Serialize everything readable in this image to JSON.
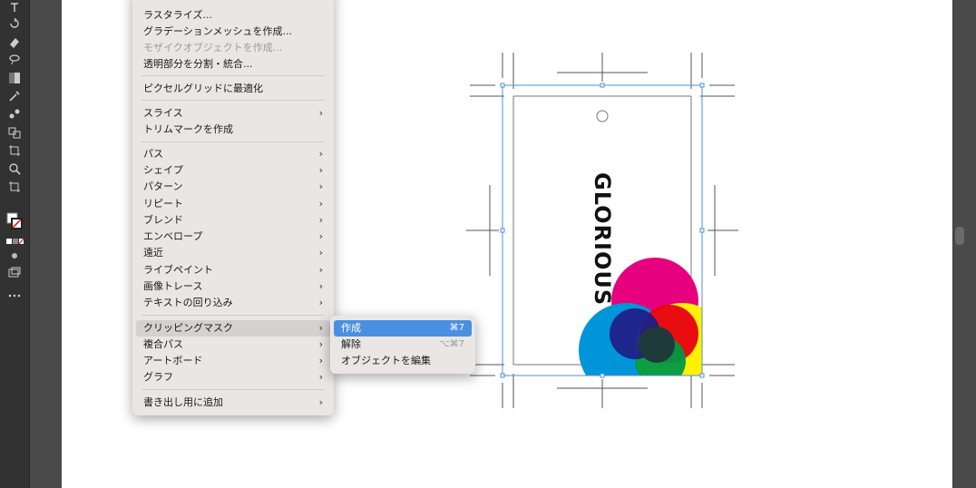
{
  "menu": {
    "items": [
      {
        "label": "ラスタライズ...",
        "arrow": "",
        "disabled": false
      },
      {
        "label": "グラデーションメッシュを作成...",
        "arrow": "",
        "disabled": false
      },
      {
        "label": "モザイクオブジェクトを作成...",
        "arrow": "",
        "disabled": true
      },
      {
        "label": "透明部分を分割・統合...",
        "arrow": "",
        "disabled": false
      },
      {
        "label": "ピクセルグリッドに最適化",
        "arrow": "",
        "disabled": false
      },
      {
        "label": "スライス",
        "arrow": "›",
        "disabled": false
      },
      {
        "label": "トリムマークを作成",
        "arrow": "",
        "disabled": false
      },
      {
        "label": "パス",
        "arrow": "›",
        "disabled": false
      },
      {
        "label": "シェイプ",
        "arrow": "›",
        "disabled": false
      },
      {
        "label": "パターン",
        "arrow": "›",
        "disabled": false
      },
      {
        "label": "リピート",
        "arrow": "›",
        "disabled": false
      },
      {
        "label": "ブレンド",
        "arrow": "›",
        "disabled": false
      },
      {
        "label": "エンベロープ",
        "arrow": "›",
        "disabled": false
      },
      {
        "label": "遠近",
        "arrow": "›",
        "disabled": false
      },
      {
        "label": "ライブペイント",
        "arrow": "›",
        "disabled": false
      },
      {
        "label": "画像トレース",
        "arrow": "›",
        "disabled": false
      },
      {
        "label": "テキストの回り込み",
        "arrow": "›",
        "disabled": false
      },
      {
        "label": "クリッピングマスク",
        "arrow": "›",
        "disabled": false
      },
      {
        "label": "複合パス",
        "arrow": "›",
        "disabled": false
      },
      {
        "label": "アートボード",
        "arrow": "›",
        "disabled": false
      },
      {
        "label": "グラフ",
        "arrow": "›",
        "disabled": false
      },
      {
        "label": "書き出し用に追加",
        "arrow": "›",
        "disabled": false
      }
    ]
  },
  "submenu": {
    "items": [
      {
        "label": "作成",
        "shortcut": "⌘7"
      },
      {
        "label": "解除",
        "shortcut": "⌥⌘7"
      },
      {
        "label": "オブジェクトを編集",
        "shortcut": ""
      }
    ]
  },
  "artwork": {
    "text": "GLORIOUS",
    "colors": {
      "magenta": "#e6007e",
      "cyan": "#0095d9",
      "yellow": "#fff100",
      "red": "#e60012",
      "green": "#009944",
      "navy": "#1d2088",
      "dark": "#1e3a3a"
    }
  },
  "icons": [
    "type-tool-icon",
    "rotate-icon",
    "eraser-icon",
    "lasso-icon",
    "gradient-icon",
    "eyedropper-icon",
    "blend-icon",
    "shape-builder-icon",
    "crop-icon",
    "zoom-icon",
    "artboard-icon",
    "fill-stroke-icon",
    "more-tools-icon"
  ]
}
